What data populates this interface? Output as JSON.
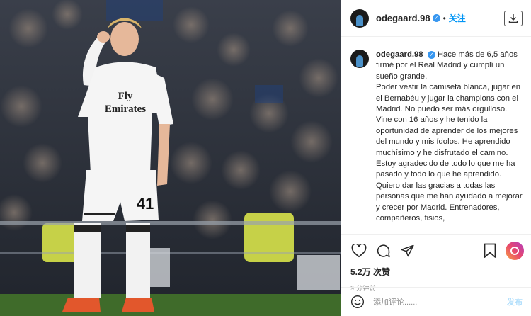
{
  "post": {
    "username": "odegaard.98",
    "follow_label": "关注",
    "separator": "•",
    "caption_username": "odegaard.98",
    "caption_text": "Hace más de 6,5 años firmé por el Real Madrid y cumplí un sueño grande.\nPoder vestir la camiseta blanca, jugar en el Bernabéu y jugar la champions con el Madrid. No puedo ser más orgulloso. Vine con 16 años y he tenido la oportunidad de aprender de los mejores del mundo y mis ídolos. He aprendido muchísimo y he disfrutado el camino. Estoy agradecido de todo lo que me ha pasado y todo lo que he aprendido. Quiero dar las gracias a todas las personas que me han ayudado a mejorar y crecer por Madrid. Entrenadores, compañeros, fisios,",
    "likes": "5.2万 次赞",
    "time": "9 分钟前",
    "comment_placeholder": "添加评论......",
    "post_label": "发布"
  },
  "photo": {
    "shirt_sponsor": "Fly\nEmirates",
    "shorts_number": "41"
  },
  "icons": {
    "verified": "verified-icon",
    "download": "download-icon",
    "like": "heart-icon",
    "comment": "comment-icon",
    "share": "share-icon",
    "save": "bookmark-icon",
    "emoji": "emoji-icon"
  },
  "colors": {
    "accent": "#0095f6",
    "verified": "#3897f0",
    "muted": "#8e8e8e"
  }
}
